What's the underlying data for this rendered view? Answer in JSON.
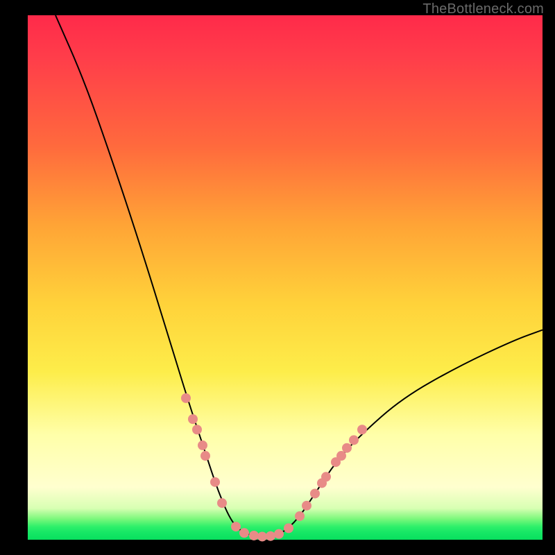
{
  "watermark": "TheBottleneck.com",
  "colors": {
    "frame_bg": "#000000",
    "dot_fill": "#e88b87",
    "curve_stroke": "#000000",
    "gradient_top": "#ff2a4a",
    "gradient_mid": "#ffd23a",
    "gradient_low": "#ffffcf",
    "gradient_bottom": "#18e866"
  },
  "chart_data": {
    "type": "line",
    "title": "",
    "xlabel": "",
    "ylabel": "",
    "xlim": [
      0,
      742
    ],
    "ylim_pct": [
      0,
      100
    ],
    "notes": "V-shaped bottleneck curve. Height is percent of plot area (0 = bottom/green/good, 100 = top/red/bad). Minimum is a flat trough around x≈300–370. Left arm rises off top; right arm rises to ~40%.",
    "curve": [
      {
        "x": 40,
        "y_pct": 100
      },
      {
        "x": 80,
        "y_pct": 88
      },
      {
        "x": 120,
        "y_pct": 73
      },
      {
        "x": 160,
        "y_pct": 57
      },
      {
        "x": 200,
        "y_pct": 40
      },
      {
        "x": 230,
        "y_pct": 27
      },
      {
        "x": 255,
        "y_pct": 17
      },
      {
        "x": 275,
        "y_pct": 9
      },
      {
        "x": 295,
        "y_pct": 3
      },
      {
        "x": 315,
        "y_pct": 1
      },
      {
        "x": 340,
        "y_pct": 0.5
      },
      {
        "x": 365,
        "y_pct": 1
      },
      {
        "x": 390,
        "y_pct": 4
      },
      {
        "x": 415,
        "y_pct": 9
      },
      {
        "x": 445,
        "y_pct": 15
      },
      {
        "x": 480,
        "y_pct": 20
      },
      {
        "x": 540,
        "y_pct": 27
      },
      {
        "x": 620,
        "y_pct": 33
      },
      {
        "x": 700,
        "y_pct": 38
      },
      {
        "x": 742,
        "y_pct": 40
      }
    ],
    "dots": [
      {
        "x": 228,
        "y_pct": 27
      },
      {
        "x": 238,
        "y_pct": 23
      },
      {
        "x": 244,
        "y_pct": 21
      },
      {
        "x": 252,
        "y_pct": 18
      },
      {
        "x": 256,
        "y_pct": 16
      },
      {
        "x": 270,
        "y_pct": 11
      },
      {
        "x": 280,
        "y_pct": 7
      },
      {
        "x": 300,
        "y_pct": 2.5
      },
      {
        "x": 312,
        "y_pct": 1.3
      },
      {
        "x": 326,
        "y_pct": 0.8
      },
      {
        "x": 338,
        "y_pct": 0.6
      },
      {
        "x": 350,
        "y_pct": 0.7
      },
      {
        "x": 362,
        "y_pct": 1.1
      },
      {
        "x": 376,
        "y_pct": 2.2
      },
      {
        "x": 392,
        "y_pct": 4.5
      },
      {
        "x": 402,
        "y_pct": 6.5
      },
      {
        "x": 414,
        "y_pct": 8.8
      },
      {
        "x": 424,
        "y_pct": 10.8
      },
      {
        "x": 430,
        "y_pct": 12
      },
      {
        "x": 444,
        "y_pct": 14.8
      },
      {
        "x": 452,
        "y_pct": 16
      },
      {
        "x": 460,
        "y_pct": 17.5
      },
      {
        "x": 470,
        "y_pct": 19
      },
      {
        "x": 482,
        "y_pct": 21
      }
    ],
    "dot_radius_px": 7
  }
}
